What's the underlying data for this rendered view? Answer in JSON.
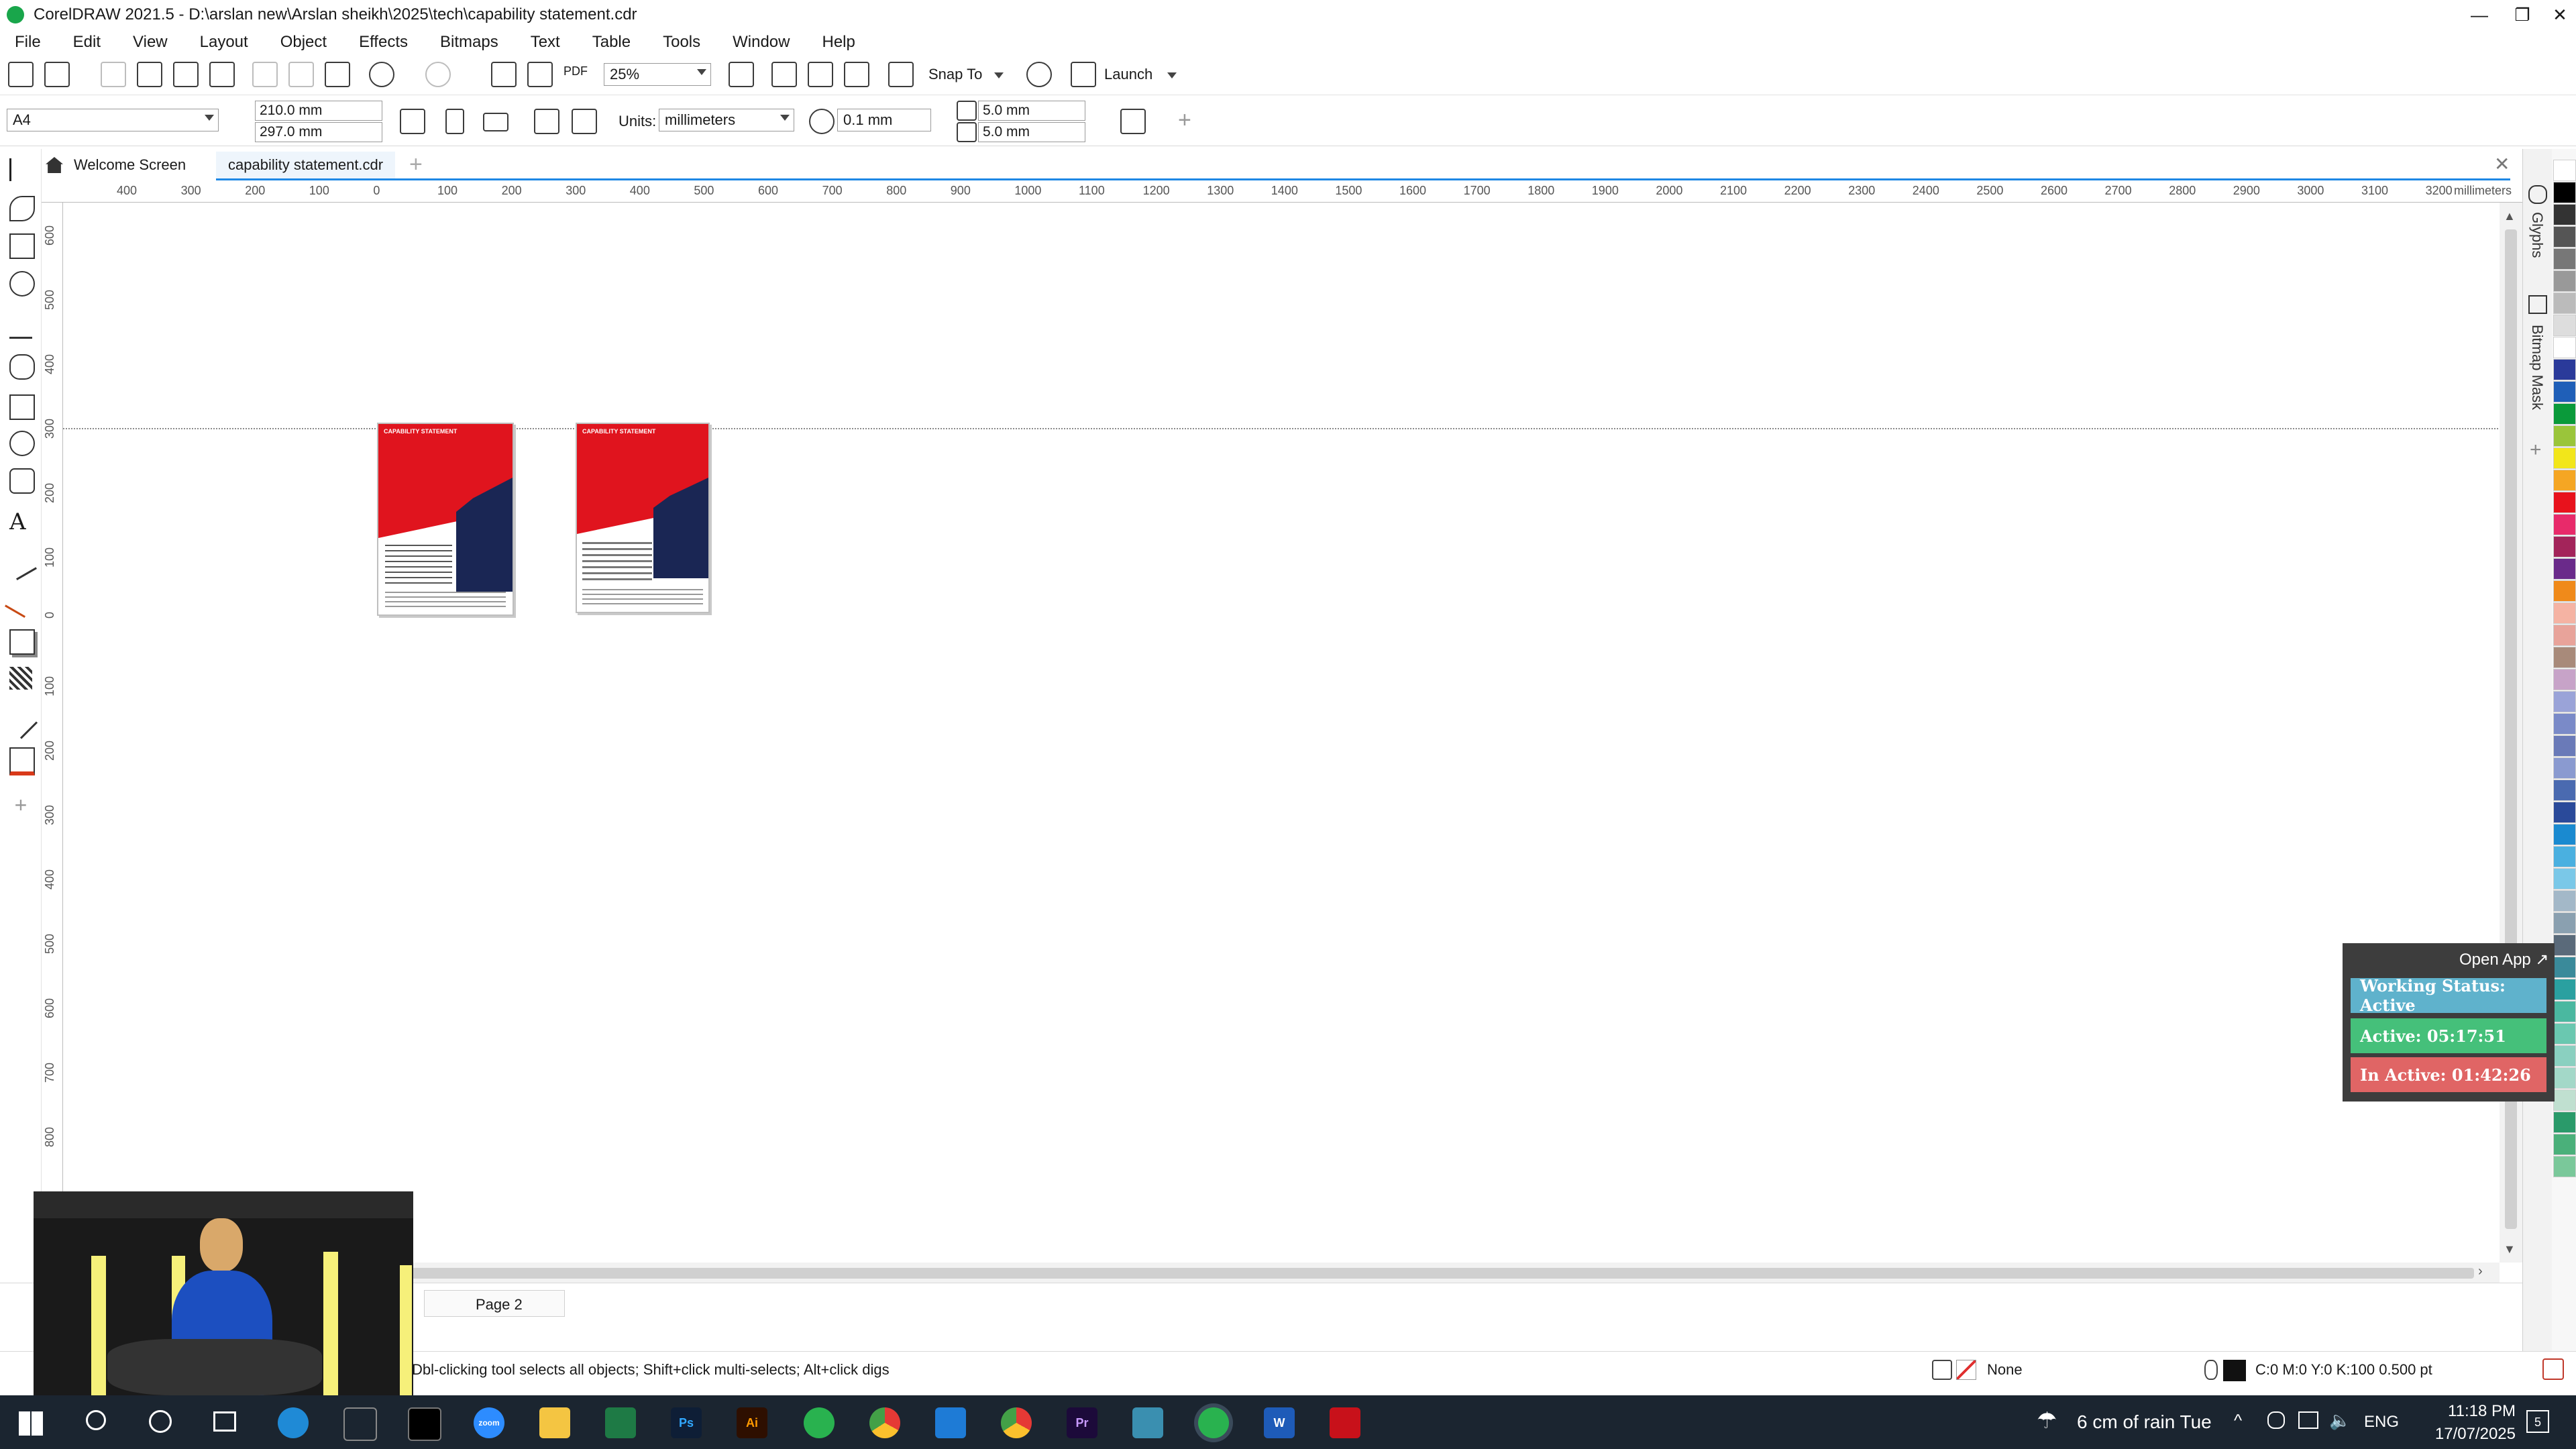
{
  "window": {
    "title": "CorelDRAW 2021.5 - D:\\arslan new\\Arslan sheikh\\2025\\tech\\capability statement.cdr",
    "minimize": "—",
    "restore": "❐",
    "close": "✕"
  },
  "menu": [
    "File",
    "Edit",
    "View",
    "Layout",
    "Object",
    "Effects",
    "Bitmaps",
    "Text",
    "Table",
    "Tools",
    "Window",
    "Help"
  ],
  "toolbar": {
    "zoom_value": "25%",
    "snap_label": "Snap To",
    "launch_label": "Launch",
    "pdf_label": "PDF"
  },
  "property_bar": {
    "page_size": "A4",
    "width": "210.0 mm",
    "height": "297.0 mm",
    "units_label": "Units:",
    "units_value": "millimeters",
    "nudge": "0.1 mm",
    "dup_x": "5.0 mm",
    "dup_y": "5.0 mm"
  },
  "tabs": {
    "welcome": "Welcome Screen",
    "document": "capability statement.cdr"
  },
  "ruler": {
    "unit": "millimeters",
    "h_labels": [
      "400",
      "300",
      "200",
      "100",
      "0",
      "100",
      "200",
      "300",
      "400",
      "500",
      "600",
      "700",
      "800",
      "900",
      "1000",
      "1100",
      "1200",
      "1300",
      "1400",
      "1500",
      "1600",
      "1700",
      "1800",
      "1900",
      "2000",
      "2100",
      "2200",
      "2300",
      "2400",
      "2500",
      "2600",
      "2700",
      "2800",
      "2900",
      "3000",
      "3100",
      "3200"
    ],
    "v_labels": [
      "600",
      "500",
      "400",
      "300",
      "200",
      "100",
      "0",
      "100",
      "200",
      "300",
      "400",
      "500",
      "600",
      "700",
      "800"
    ]
  },
  "pages": {
    "page1_heading": "CAPABILITY STATEMENT",
    "page2_heading": "CAPABILITY STATEMENT"
  },
  "dockers": {
    "glyphs": "Glyphs",
    "bitmap_mask": "Bitmap Mask"
  },
  "page_nav": {
    "page_label": "Page 2"
  },
  "status": {
    "hint": "Dbl-clicking tool selects all objects; Shift+click multi-selects; Alt+click digs",
    "fill": "None",
    "outline": "C:0 M:0 Y:0 K:100  0.500 pt"
  },
  "widget": {
    "open_app": "Open App ↗",
    "working": "Working Status: Active",
    "active": "Active: 05:17:51",
    "inactive": "In Active: 01:42:26"
  },
  "taskbar": {
    "weather": "6 cm of rain Tue",
    "lang": "ENG",
    "time": "11:18 PM",
    "date": "17/07/2025",
    "notif_count": "5",
    "apps": [
      "zoom",
      "Ps",
      "Ai",
      "Pr",
      "W"
    ]
  },
  "colors": {
    "accent": "#1e88e5",
    "doc_red": "#e0141e",
    "doc_navy": "#1a2654",
    "widget_blue": "#5fb2cc",
    "widget_green": "#45c07a",
    "widget_red": "#e06565"
  }
}
